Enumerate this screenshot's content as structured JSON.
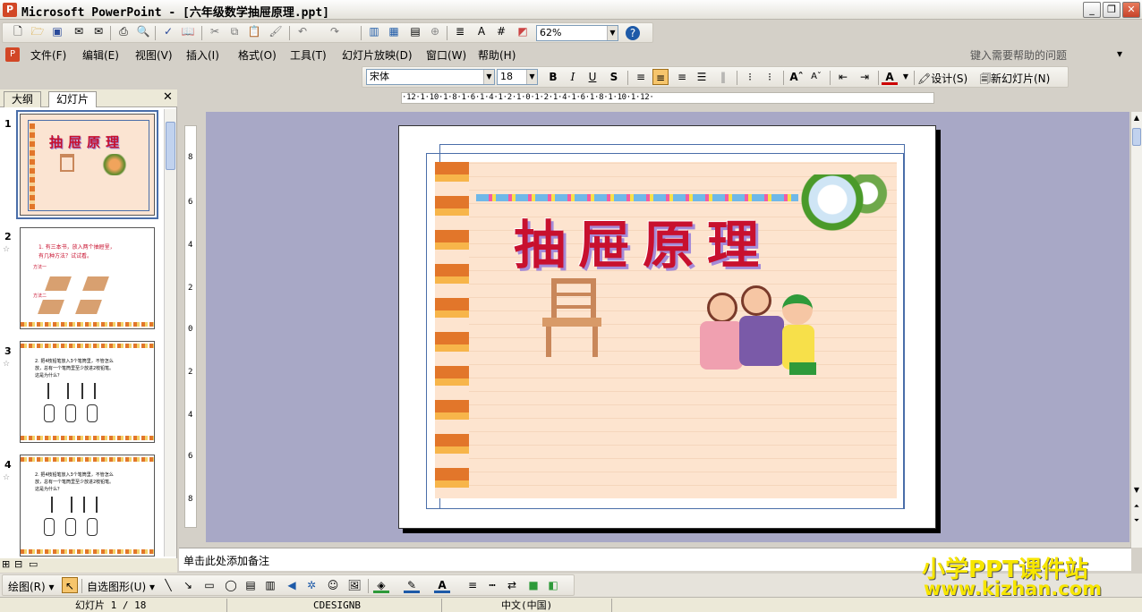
{
  "window": {
    "title": "Microsoft PowerPoint - [六年级数学抽屉原理.ppt]",
    "app_icon": "P"
  },
  "standard_toolbar": {
    "zoom": "62%",
    "help_icon": "?"
  },
  "menu": {
    "items": [
      "文件(F)",
      "编辑(E)",
      "视图(V)",
      "插入(I)",
      "格式(O)",
      "工具(T)",
      "幻灯片放映(D)",
      "窗口(W)",
      "帮助(H)"
    ],
    "help_placeholder": "键入需要帮助的问题"
  },
  "formatting_toolbar": {
    "font": "宋体",
    "size": "18",
    "bold": "B",
    "italic": "I",
    "underline": "U",
    "shadow": "S",
    "font_color": "A",
    "design": "设计(S)",
    "new_slide": "新幻灯片(N)"
  },
  "left_pane": {
    "tabs": [
      "大纲",
      "幻灯片"
    ],
    "active_tab": "幻灯片",
    "slides": [
      {
        "num": "1",
        "title": "抽屉原理"
      },
      {
        "num": "2",
        "line1": "1. 有三本书，放入两个抽屉里，",
        "line2": "有几种方法？试试看。",
        "label_a": "方法一",
        "label_b": "方法二"
      },
      {
        "num": "3",
        "line1": "2. 把4枝铅笔放入3个笔筒里，不管怎么",
        "line2": "放，总有一个笔筒里至少放进2枝铅笔。",
        "line3": "这是为什么？"
      },
      {
        "num": "4",
        "line1": "2. 把4枝铅笔放入3个笔筒里，不管怎么",
        "line2": "放，总有一个笔筒里至少放进2枝铅笔。",
        "line3": "这是为什么？"
      }
    ]
  },
  "ruler": {
    "horizontal": "·12·1·10·1·8·1·6·1·4·1·2·1·0·1·2·1·4·1·6·1·8·1·10·1·12·",
    "vertical": [
      "8",
      "6",
      "4",
      "2",
      "0",
      "2",
      "4",
      "6",
      "8"
    ]
  },
  "slide": {
    "title": "抽屉原理"
  },
  "notes": {
    "placeholder": "单击此处添加备注"
  },
  "draw_toolbar": {
    "draw": "绘图(R)",
    "autoshapes": "自选图形(U)"
  },
  "watermark": {
    "line1": "小学PPT课件站",
    "line2": "www.kjzhan.com"
  },
  "status": {
    "slide": "幻灯片 1 / 18",
    "design": "CDESIGNB",
    "language": "中文(中国)"
  },
  "colors": {
    "accent": "#0a246a",
    "title_red": "#c8102e",
    "watermark_yellow": "#f7e600"
  }
}
